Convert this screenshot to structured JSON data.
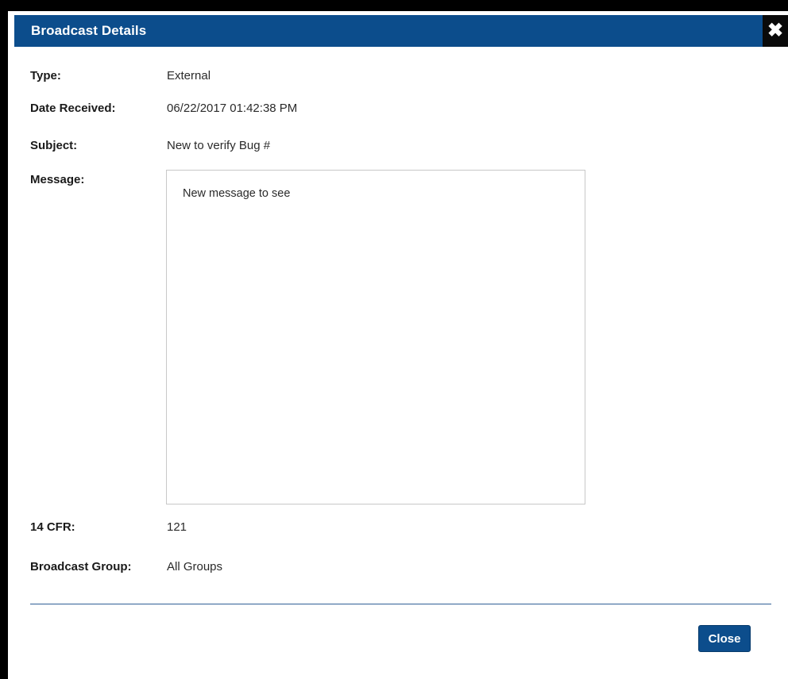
{
  "dialog": {
    "title": "Broadcast Details",
    "close_icon": "close-icon"
  },
  "fields": {
    "type_label": "Type:",
    "type_value": "External",
    "date_label": "Date Received:",
    "date_value": "06/22/2017 01:42:38 PM",
    "subject_label": "Subject:",
    "subject_value": "New to verify Bug #",
    "message_label": "Message:",
    "message_value": "New message to see",
    "cfr_label": "14 CFR:",
    "cfr_value": "121",
    "group_label": "Broadcast Group:",
    "group_value": "All Groups"
  },
  "footer": {
    "close_label": "Close"
  },
  "colors": {
    "header_bg": "#0c4d8c",
    "divider": "#2f5f96"
  }
}
